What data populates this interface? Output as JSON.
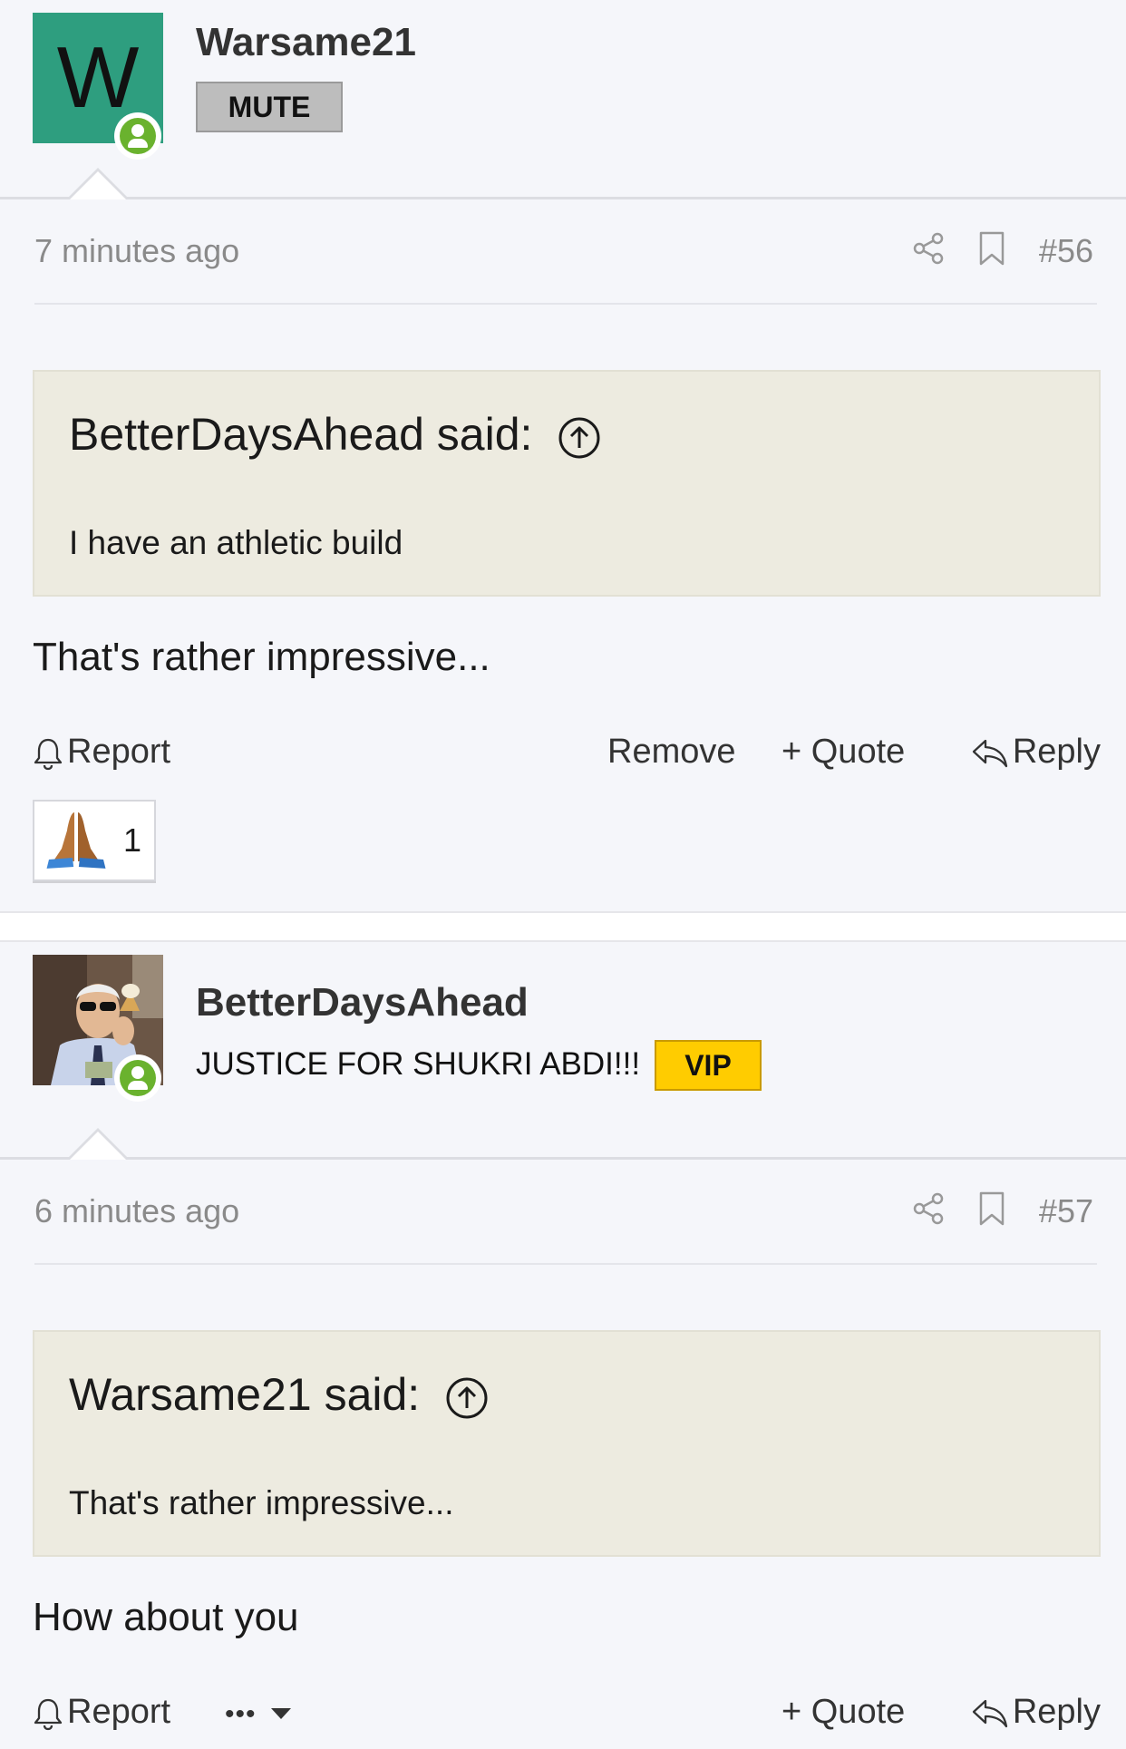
{
  "posts": [
    {
      "username": "Warsame21",
      "avatar_letter": "W",
      "badge": "MUTE",
      "timestamp": "7 minutes ago",
      "post_number": "#56",
      "quote": {
        "author": "BetterDaysAhead said:",
        "text": "I have an athletic build"
      },
      "message": "That's rather impressive...",
      "actions": {
        "report": "Report",
        "remove": "Remove",
        "quote": "+ Quote",
        "reply": "Reply"
      },
      "reaction": {
        "emoji_icon": "folded-hands-icon",
        "count": "1"
      }
    },
    {
      "username": "BetterDaysAhead",
      "user_title": "JUSTICE FOR SHUKRI ABDI!!!",
      "badge": "VIP",
      "timestamp": "6 minutes ago",
      "post_number": "#57",
      "quote": {
        "author": "Warsame21 said:",
        "text": "That's rather impressive..."
      },
      "message": "How about you",
      "actions": {
        "report": "Report",
        "more": "•••",
        "quote": "+ Quote",
        "reply": "Reply"
      }
    }
  ],
  "colors": {
    "avatar_bg": "#2e9e7f",
    "online": "#6ab22e",
    "vip": "#ffcc00",
    "quote_bg": "#edebe0",
    "page_bg": "#f5f6fa"
  }
}
